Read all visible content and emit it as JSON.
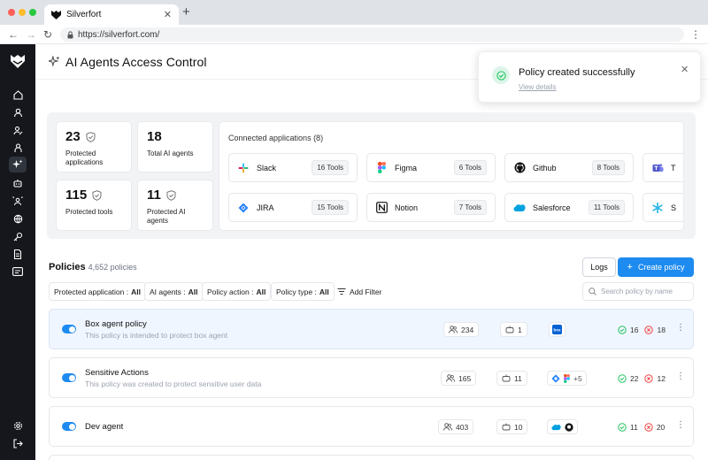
{
  "browser": {
    "tab_title": "Silverfort",
    "tab_close": "✕",
    "new_tab": "+",
    "url": "https://silverfort.com/"
  },
  "page": {
    "title": "AI Agents Access Control"
  },
  "toast": {
    "title": "Policy created successfully",
    "link": "View details"
  },
  "stats": {
    "protected_applications": {
      "value": "23",
      "label": "Protected applications"
    },
    "total_ai_agents": {
      "value": "18",
      "label": "Total AI agents"
    },
    "protected_tools": {
      "value": "115",
      "label": "Protected tools"
    },
    "protected_ai_agents": {
      "value": "11",
      "label": "Protected AI agents"
    }
  },
  "connected": {
    "heading": "Connected applications (8)",
    "apps": [
      {
        "name": "Slack",
        "tools": "16 Tools",
        "icon": "slack-icon"
      },
      {
        "name": "Figma",
        "tools": "6 Tools",
        "icon": "figma-icon"
      },
      {
        "name": "Github",
        "tools": "8 Tools",
        "icon": "github-icon"
      },
      {
        "name": "T",
        "tools": "",
        "icon": "teams-icon"
      },
      {
        "name": "JIRA",
        "tools": "15 Tools",
        "icon": "jira-icon"
      },
      {
        "name": "Notion",
        "tools": "7 Tools",
        "icon": "notion-icon"
      },
      {
        "name": "Salesforce",
        "tools": "11 Tools",
        "icon": "salesforce-icon"
      },
      {
        "name": "S",
        "tools": "",
        "icon": "snowflake-icon"
      }
    ]
  },
  "policies": {
    "heading": "Policies",
    "count": "4,652 policies",
    "logs_label": "Logs",
    "create_label": "Create policy",
    "search_placeholder": "Search policy by name",
    "add_filter": "Add Filter",
    "filters": [
      {
        "label": "Protected application :",
        "value": "All"
      },
      {
        "label": "AI agents :",
        "value": "All"
      },
      {
        "label": "Policy action :",
        "value": "All"
      },
      {
        "label": "Policy type :",
        "value": "All"
      }
    ],
    "rows": [
      {
        "name": "Box agent policy",
        "description": "This policy is intended to protect box agent",
        "users": "234",
        "agents": "1",
        "apps": [
          "box"
        ],
        "more_apps": "",
        "allowed": "16",
        "denied": "18"
      },
      {
        "name": "Sensitive Actions",
        "description": "This policy was created to protect sensitive user data",
        "users": "165",
        "agents": "11",
        "apps": [
          "jira",
          "figma"
        ],
        "more_apps": "+5",
        "allowed": "22",
        "denied": "12"
      },
      {
        "name": "Dev agent",
        "description": "",
        "users": "403",
        "agents": "10",
        "apps": [
          "salesforce",
          "github"
        ],
        "more_apps": "",
        "allowed": "11",
        "denied": "20"
      }
    ]
  },
  "colors": {
    "accent": "#1d8bf0",
    "sidebar": "#15171c",
    "success": "#22c55e",
    "danger": "#ef4444"
  }
}
